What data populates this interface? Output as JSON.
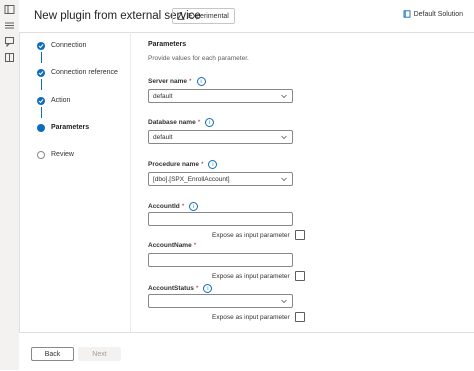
{
  "header": {
    "title": "New plugin from external service",
    "badge": "Experimental",
    "solution": "Default Solution"
  },
  "steps": [
    {
      "label": "Connection",
      "state": "done"
    },
    {
      "label": "Connection reference",
      "state": "done"
    },
    {
      "label": "Action",
      "state": "done"
    },
    {
      "label": "Parameters",
      "state": "current"
    },
    {
      "label": "Review",
      "state": "todo"
    }
  ],
  "section": {
    "title": "Parameters",
    "description": "Provide values for each parameter."
  },
  "fields": {
    "server": {
      "label": "Server name",
      "required": "*",
      "value": "default"
    },
    "database": {
      "label": "Database name",
      "required": "*",
      "value": "default"
    },
    "procedure": {
      "label": "Procedure name",
      "required": "*",
      "value": "[dbo].[SPX_EnrollAccount]"
    },
    "accountid": {
      "label": "AccountId",
      "required": "*",
      "value": "",
      "expose": "Expose as input parameter"
    },
    "accountname": {
      "label": "AccountName",
      "required": "*",
      "value": "",
      "expose": "Expose as input parameter"
    },
    "accountstatus": {
      "label": "AccountStatus",
      "required": "*",
      "value": "",
      "expose": "Expose as input parameter"
    }
  },
  "footer": {
    "back": "Back",
    "next": "Next"
  },
  "colors": {
    "accent": "#0f6cbd",
    "required": "#a4262c"
  },
  "icons": {
    "info": "i"
  }
}
